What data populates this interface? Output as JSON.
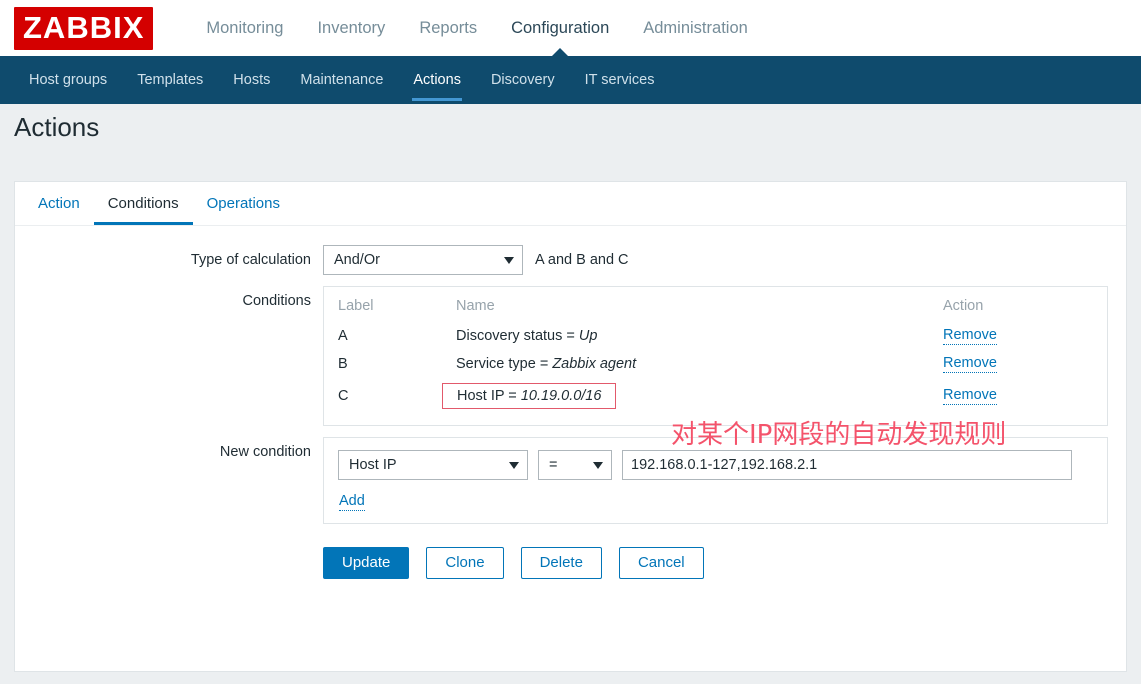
{
  "brand": {
    "logo_text": "ZABBIX",
    "logo_bg": "#d40000"
  },
  "topnav": {
    "items": [
      {
        "label": "Monitoring",
        "selected": false
      },
      {
        "label": "Inventory",
        "selected": false
      },
      {
        "label": "Reports",
        "selected": false
      },
      {
        "label": "Configuration",
        "selected": true
      },
      {
        "label": "Administration",
        "selected": false
      }
    ]
  },
  "subnav": {
    "items": [
      {
        "label": "Host groups",
        "selected": false
      },
      {
        "label": "Templates",
        "selected": false
      },
      {
        "label": "Hosts",
        "selected": false
      },
      {
        "label": "Maintenance",
        "selected": false
      },
      {
        "label": "Actions",
        "selected": true
      },
      {
        "label": "Discovery",
        "selected": false
      },
      {
        "label": "IT services",
        "selected": false
      }
    ]
  },
  "page": {
    "title": "Actions"
  },
  "tabs": [
    {
      "label": "Action",
      "selected": false
    },
    {
      "label": "Conditions",
      "selected": true
    },
    {
      "label": "Operations",
      "selected": false
    }
  ],
  "form": {
    "type_of_calculation": {
      "label": "Type of calculation",
      "value": "And/Or",
      "formula": "A and B and C"
    },
    "conditions": {
      "label": "Conditions",
      "headers": {
        "label": "Label",
        "name": "Name",
        "action": "Action"
      },
      "rows": [
        {
          "label": "A",
          "name_prefix": "Discovery status = ",
          "name_value": "Up",
          "action": "Remove",
          "highlighted": false
        },
        {
          "label": "B",
          "name_prefix": "Service type = ",
          "name_value": "Zabbix agent",
          "action": "Remove",
          "highlighted": false
        },
        {
          "label": "C",
          "name_prefix": "Host IP = ",
          "name_value": "10.19.0.0/16",
          "action": "Remove",
          "highlighted": true
        }
      ]
    },
    "new_condition": {
      "label": "New condition",
      "type_value": "Host IP",
      "operator_value": "=",
      "input_value": "192.168.0.1-127,192.168.2.1",
      "input_placeholder": "",
      "add_label": "Add"
    }
  },
  "annotation": {
    "text": "对某个IP网段的自动发现规则",
    "color": "#f4536b"
  },
  "footer": {
    "buttons": [
      {
        "label": "Update",
        "primary": true
      },
      {
        "label": "Clone",
        "primary": false
      },
      {
        "label": "Delete",
        "primary": false
      },
      {
        "label": "Cancel",
        "primary": false
      }
    ]
  },
  "colors": {
    "brand_red": "#d40000",
    "subnav_bg": "#0f4b6d",
    "link_blue": "#0275b8",
    "accent_blue": "#4397d3",
    "annotation_red": "#f4536b",
    "highlight_border": "#e2596b"
  }
}
